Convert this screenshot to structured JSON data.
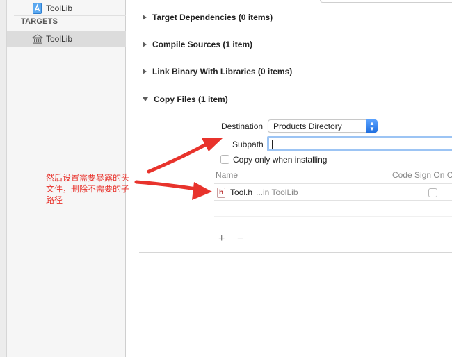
{
  "navigator": {
    "project_item": "ToolLib",
    "targets_header": "TARGETS",
    "target_item": "ToolLib"
  },
  "phases": {
    "target_dependencies": "Target Dependencies (0 items)",
    "compile_sources": "Compile Sources (1 item)",
    "link_binary": "Link Binary With Libraries (0 items)",
    "copy_files": "Copy Files (1 item)"
  },
  "copy_files": {
    "destination_label": "Destination",
    "destination_value": "Products Directory",
    "subpath_label": "Subpath",
    "subpath_value": "",
    "copy_only_label": "Copy only when installing",
    "table": {
      "col_name": "Name",
      "col_codesign": "Code Sign On Co",
      "rows": [
        {
          "file": "Tool.h",
          "location": "...in ToolLib"
        }
      ]
    },
    "add_button": "+",
    "remove_button": "−"
  },
  "annotation": {
    "text": "然后设置需要暴露的头文件，删除不需要的子路径",
    "color": "#e8332c"
  },
  "colors": {
    "accent": "#1f6fe0",
    "focus_ring": "#9cc4f4"
  }
}
